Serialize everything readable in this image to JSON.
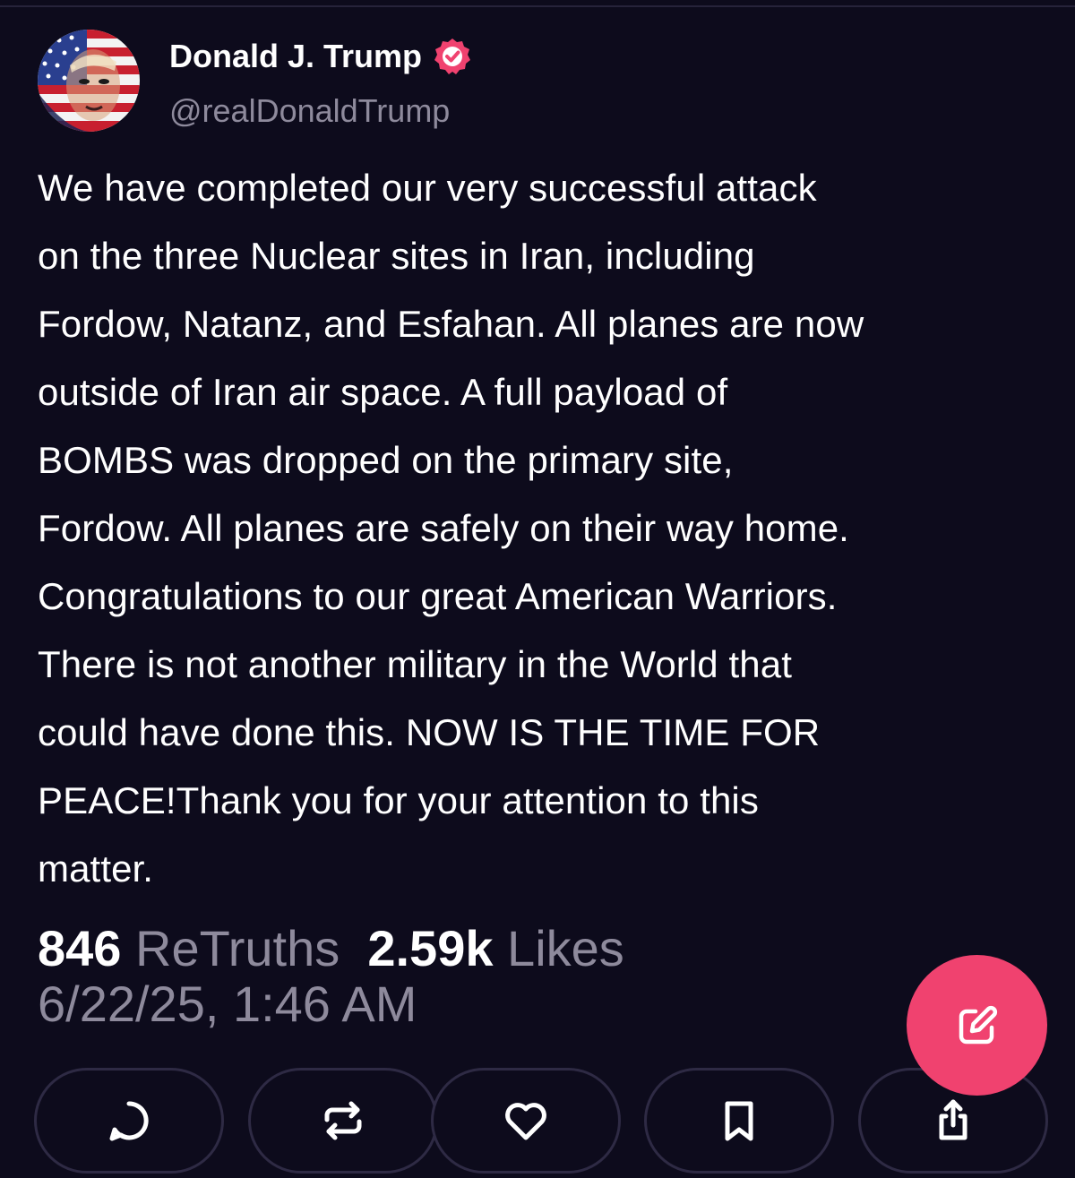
{
  "author": {
    "display_name": "Donald J. Trump",
    "handle": "@realDonaldTrump",
    "verified": true,
    "verified_color": "#f0426f"
  },
  "post": {
    "lines": [
      "We have completed our very successful attack",
      "on the three Nuclear sites in Iran, including",
      "Fordow, Natanz, and Esfahan. All planes are now",
      "outside of Iran air space. A full payload of",
      "BOMBS was dropped on the primary site,",
      "Fordow. All planes are safely on their way home.",
      "Congratulations to our great American Warriors.",
      "There is not another military in the World that",
      "could have done this. NOW IS THE TIME FOR",
      "PEACE!Thank you for your attention to this",
      "matter."
    ]
  },
  "stats": {
    "retruths_count": "846",
    "retruths_label": "ReTruths",
    "likes_count": "2.59k",
    "likes_label": "Likes"
  },
  "timestamp": "6/22/25, 1:46 AM",
  "actions": [
    {
      "name": "reply",
      "icon": "reply-icon"
    },
    {
      "name": "retruth",
      "icon": "retruth-icon"
    },
    {
      "name": "like",
      "icon": "heart-icon"
    },
    {
      "name": "bookmark",
      "icon": "bookmark-icon"
    },
    {
      "name": "share",
      "icon": "share-icon"
    }
  ],
  "compose": {
    "icon": "compose-icon"
  },
  "colors": {
    "background": "#0d0b1c",
    "accent": "#f0426f",
    "muted_text": "#8e8a9c",
    "button_border": "#2e2a44"
  }
}
